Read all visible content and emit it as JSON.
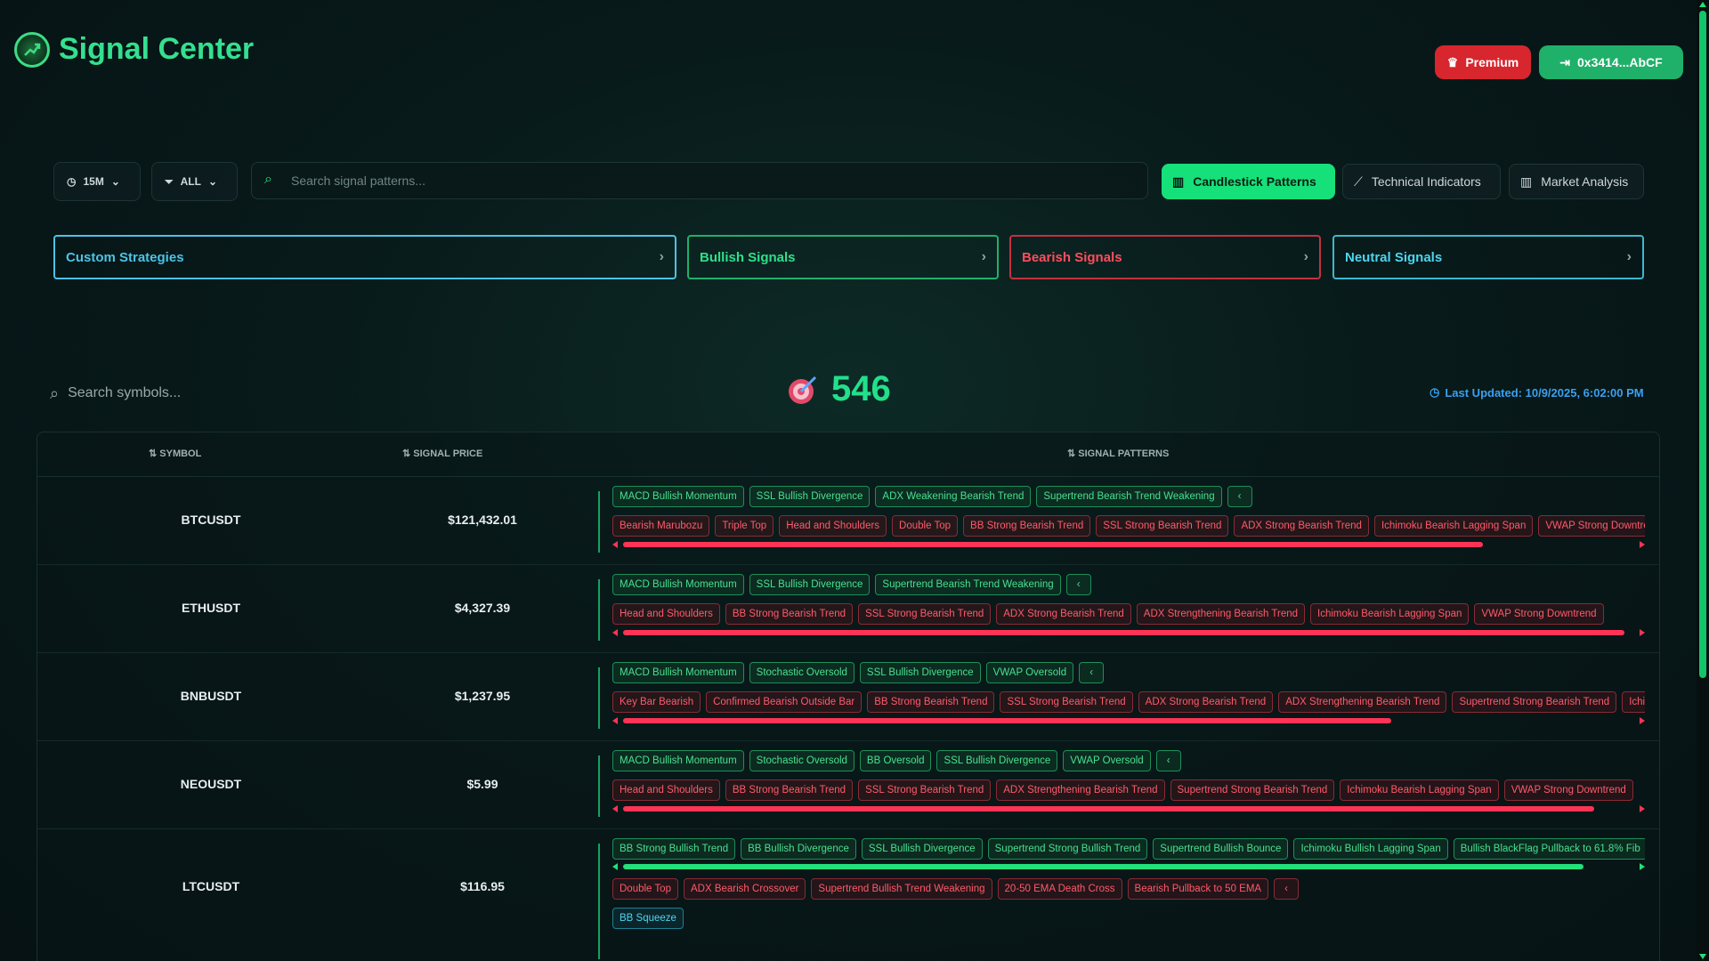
{
  "app": {
    "title": "Signal Center"
  },
  "header": {
    "premium_label": "Premium",
    "wallet_label": "0x3414...AbCF"
  },
  "filters": {
    "timeframe": "15M",
    "filter": "ALL",
    "search_placeholder": "Search signal patterns..."
  },
  "tabs": [
    {
      "label": "Candlestick Patterns",
      "active": true
    },
    {
      "label": "Technical Indicators",
      "active": false
    },
    {
      "label": "Market Analysis",
      "active": false
    }
  ],
  "categories": [
    {
      "label": "Custom Strategies",
      "color": "#4cc3e8"
    },
    {
      "label": "Bullish Signals",
      "color": "#2ee08a"
    },
    {
      "label": "Bearish Signals",
      "color": "#ff4d5e"
    },
    {
      "label": "Neutral Signals",
      "color": "#4cd6f0"
    }
  ],
  "symbol_search": {
    "placeholder": "Search symbols..."
  },
  "signal_count": "546",
  "last_updated": "Last Updated: 10/9/2025, 6:02:00 PM",
  "table": {
    "headers": {
      "symbol": "SYMBOL",
      "price": "SIGNAL PRICE",
      "patterns": "SIGNAL PATTERNS"
    },
    "rows": [
      {
        "symbol": "BTCUSDT",
        "price": "$121,432.01",
        "bullish": [
          "MACD Bullish Momentum",
          "SSL Bullish Divergence",
          "ADX Weakening Bearish Trend",
          "Supertrend Bearish Trend Weakening"
        ],
        "bearish": [
          "Bearish Marubozu",
          "Triple Top",
          "Head and Shoulders",
          "Double Top",
          "BB Strong Bearish Trend",
          "SSL Strong Bearish Trend",
          "ADX Strong Bearish Trend",
          "Ichimoku Bearish Lagging Span",
          "VWAP Strong Downtrend"
        ],
        "bearish_scroll": 0.85,
        "neutral": []
      },
      {
        "symbol": "ETHUSDT",
        "price": "$4,327.39",
        "bullish": [
          "MACD Bullish Momentum",
          "SSL Bullish Divergence",
          "Supertrend Bearish Trend Weakening"
        ],
        "bearish": [
          "Head and Shoulders",
          "BB Strong Bearish Trend",
          "SSL Strong Bearish Trend",
          "ADX Strong Bearish Trend",
          "ADX Strengthening Bearish Trend",
          "Ichimoku Bearish Lagging Span",
          "VWAP Strong Downtrend"
        ],
        "bearish_scroll": 0.99,
        "neutral": []
      },
      {
        "symbol": "BNBUSDT",
        "price": "$1,237.95",
        "bullish": [
          "MACD Bullish Momentum",
          "Stochastic Oversold",
          "SSL Bullish Divergence",
          "VWAP Oversold"
        ],
        "bearish": [
          "Key Bar Bearish",
          "Confirmed Bearish Outside Bar",
          "BB Strong Bearish Trend",
          "SSL Strong Bearish Trend",
          "ADX Strong Bearish Trend",
          "ADX Strengthening Bearish Trend",
          "Supertrend Strong Bearish Trend",
          "Ichimoku Bearish Lagging Span"
        ],
        "bearish_scroll": 0.76,
        "neutral": []
      },
      {
        "symbol": "NEOUSDT",
        "price": "$5.99",
        "bullish": [
          "MACD Bullish Momentum",
          "Stochastic Oversold",
          "BB Oversold",
          "SSL Bullish Divergence",
          "VWAP Oversold"
        ],
        "bearish": [
          "Head and Shoulders",
          "BB Strong Bearish Trend",
          "SSL Strong Bearish Trend",
          "ADX Strengthening Bearish Trend",
          "Supertrend Strong Bearish Trend",
          "Ichimoku Bearish Lagging Span",
          "VWAP Strong Downtrend"
        ],
        "bearish_scroll": 0.96,
        "neutral": []
      },
      {
        "symbol": "LTCUSDT",
        "price": "$116.95",
        "bullish": [
          "BB Strong Bullish Trend",
          "BB Bullish Divergence",
          "SSL Bullish Divergence",
          "Supertrend Strong Bullish Trend",
          "Supertrend Bullish Bounce",
          "Ichimoku Bullish Lagging Span",
          "Bullish BlackFlag Pullback to 61.8% Fib"
        ],
        "bullish_scroll": 0.95,
        "bearish": [
          "Double Top",
          "ADX Bearish Crossover",
          "Supertrend Bullish Trend Weakening",
          "20-50 EMA Death Cross",
          "Bearish Pullback to 50 EMA"
        ],
        "neutral": [
          "BB Squeeze"
        ]
      }
    ]
  }
}
